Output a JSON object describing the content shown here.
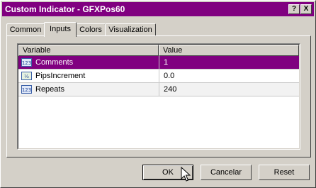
{
  "window": {
    "title": "Custom Indicator - GFXPos60"
  },
  "titlebar_buttons": {
    "help": "?",
    "close": "X"
  },
  "tabs": [
    {
      "label": "Common"
    },
    {
      "label": "Inputs"
    },
    {
      "label": "Colors"
    },
    {
      "label": "Visualization"
    }
  ],
  "active_tab": "Inputs",
  "table": {
    "columns": [
      "Variable",
      "Value"
    ],
    "rows": [
      {
        "icon": "integer-param-icon",
        "name": "Comments",
        "value": "1",
        "selected": true
      },
      {
        "icon": "double-param-icon",
        "name": "PipsIncrement",
        "value": "0.0",
        "selected": false
      },
      {
        "icon": "integer-param-icon",
        "name": "Repeats",
        "value": "240",
        "selected": false
      }
    ]
  },
  "buttons": {
    "ok": "OK",
    "cancel": "Cancelar",
    "reset": "Reset"
  },
  "colors": {
    "titlebar": "#800080",
    "selection": "#800080",
    "face": "#d4d0c8"
  }
}
